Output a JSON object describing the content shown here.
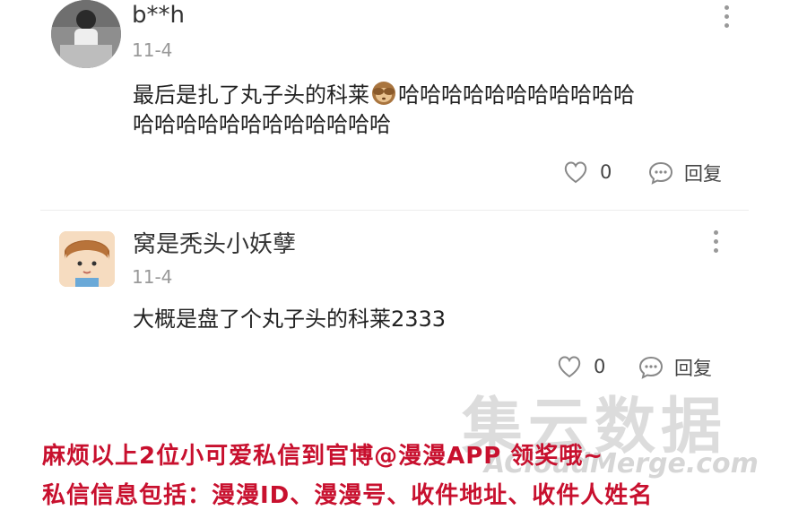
{
  "comments": [
    {
      "username": "b**h",
      "date": "11-4",
      "text_line1": "最后是扎了丸子头的科莱",
      "text_line1_after_emoji": "哈哈哈哈哈哈哈哈哈哈哈",
      "text_line2": "哈哈哈哈哈哈哈哈哈哈哈哈",
      "emoji_icon": "monkey-see-no-evil-icon",
      "like_count": "0",
      "reply_label": "回复"
    },
    {
      "username": "窝是秃头小妖孽",
      "date": "11-4",
      "text_line1": "大概是盘了个丸子头的科莱2333",
      "like_count": "0",
      "reply_label": "回复"
    }
  ],
  "watermark": {
    "main": "集云数据",
    "sub": "ACloudMerge.com"
  },
  "notice": {
    "line1": "麻烦以上2位小可爱私信到官博@漫漫APP 领奖哦~",
    "line2": "私信信息包括：漫漫ID、漫漫号、收件地址、收件人姓名"
  },
  "colors": {
    "notice_red": "#c8102e",
    "muted": "#999999"
  }
}
